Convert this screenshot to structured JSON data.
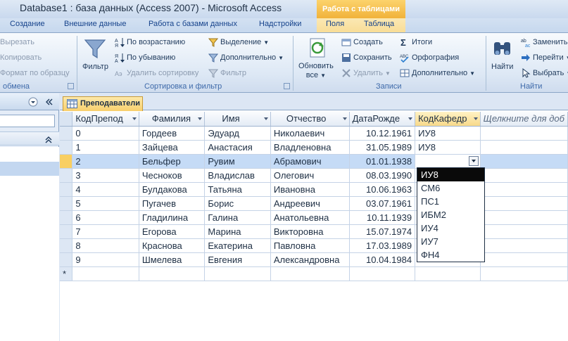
{
  "titlebar": {
    "title": "Database1 : база данных (Access 2007)  -  Microsoft Access",
    "contextual_group": "Работа с таблицами"
  },
  "tabs": {
    "items": [
      "Создание",
      "Внешние данные",
      "Работа с базами данных",
      "Надстройки"
    ],
    "contextual": [
      "Поля",
      "Таблица"
    ]
  },
  "ribbon": {
    "clipboard": {
      "cut": "Вырезать",
      "copy": "Копировать",
      "format_painter": "Формат по образцу",
      "label": "обмена"
    },
    "sort_filter": {
      "filter": "Фильтр",
      "ascending": "По возрастанию",
      "descending": "По убыванию",
      "remove_sort": "Удалить сортировку",
      "selection": "Выделение",
      "advanced": "Дополнительно",
      "toggle_filter": "Фильтр",
      "label": "Сортировка и фильтр"
    },
    "records": {
      "refresh_line1": "Обновить",
      "refresh_line2": "все",
      "new": "Создать",
      "save": "Сохранить",
      "delete": "Удалить",
      "totals": "Итоги",
      "spelling": "Орфография",
      "more": "Дополнительно",
      "label": "Записи"
    },
    "find": {
      "find": "Найти",
      "replace": "Заменить",
      "goto": "Перейти",
      "select": "Выбрать",
      "label": "Найти"
    }
  },
  "document": {
    "tab_title": "Преподаватели"
  },
  "grid": {
    "columns": [
      "КодПрепод",
      "Фамилия",
      "Имя",
      "Отчество",
      "ДатаРожде",
      "КодКафедр",
      "Щелкните для доб"
    ],
    "rows": [
      {
        "id": "0",
        "last": "Гордеев",
        "first": "Эдуард",
        "middle": "Николаевич",
        "dob": "10.12.1961",
        "dept": "ИУ8"
      },
      {
        "id": "1",
        "last": "Зайцева",
        "first": "Анастасия",
        "middle": "Владленовна",
        "dob": "31.05.1989",
        "dept": "ИУ8"
      },
      {
        "id": "2",
        "last": "Бельфер",
        "first": "Рувим",
        "middle": "Абрамович",
        "dob": "01.01.1938",
        "dept": ""
      },
      {
        "id": "3",
        "last": "Чесноков",
        "first": "Владислав",
        "middle": "Олегович",
        "dob": "08.03.1990",
        "dept": ""
      },
      {
        "id": "4",
        "last": "Булдакова",
        "first": "Татьяна",
        "middle": "Ивановна",
        "dob": "10.06.1963",
        "dept": ""
      },
      {
        "id": "5",
        "last": "Пугачев",
        "first": "Борис",
        "middle": "Андреевич",
        "dob": "03.07.1961",
        "dept": ""
      },
      {
        "id": "6",
        "last": "Гладилина",
        "first": "Галина",
        "middle": "Анатольевна",
        "dob": "10.11.1939",
        "dept": ""
      },
      {
        "id": "7",
        "last": "Егорова",
        "first": "Марина",
        "middle": "Викторовна",
        "dob": "15.07.1974",
        "dept": ""
      },
      {
        "id": "8",
        "last": "Краснова",
        "first": "Екатерина",
        "middle": "Павловна",
        "dob": "17.03.1989",
        "dept": ""
      },
      {
        "id": "9",
        "last": "Шмелева",
        "first": "Евгения",
        "middle": "Александровна",
        "dob": "10.04.1984",
        "dept": ""
      }
    ],
    "new_row_marker": "*"
  },
  "dropdown": {
    "options": [
      "ИУ8",
      "СМ6",
      "ПС1",
      "ИБМ2",
      "ИУ4",
      "ИУ7",
      "ФН4"
    ],
    "selected": "ИУ8"
  },
  "icons": {
    "filter": "funnel-icon",
    "refresh": "refresh-icon",
    "find": "binoculars-icon",
    "table": "table-icon"
  },
  "colors": {
    "accent": "#f9cf62",
    "ribbon_bg": "#dde8f5",
    "row_highlight": "#c5dbf6",
    "dropdown_selected": "#0a0a0a"
  }
}
